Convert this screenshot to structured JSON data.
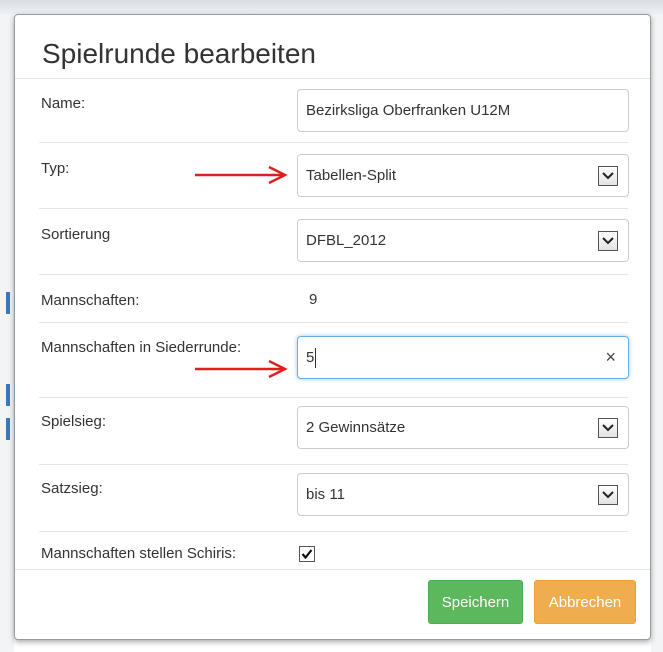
{
  "dialog": {
    "title": "Spielrunde bearbeiten"
  },
  "form": {
    "name": {
      "label": "Name:",
      "value": "Bezirksliga Oberfranken U12M"
    },
    "typ": {
      "label": "Typ:",
      "value": "Tabellen-Split"
    },
    "sortierung": {
      "label": "Sortierung",
      "value": "DFBL_2012"
    },
    "mannschaften": {
      "label": "Mannschaften:",
      "value": "9"
    },
    "siederrunde": {
      "label": "Mannschaften in Siederrunde:",
      "value": "5",
      "clear_icon": "×"
    },
    "spielsieg": {
      "label": "Spielsieg:",
      "value": "2 Gewinnsätze"
    },
    "satzsieg": {
      "label": "Satzsieg:",
      "value": "bis 11"
    },
    "schiris": {
      "label": "Mannschaften stellen Schiris:",
      "checked": true
    }
  },
  "footer": {
    "save_label": "Speichern",
    "cancel_label": "Abbrechen"
  },
  "colors": {
    "save": "#5cb85c",
    "cancel": "#f0ad4e",
    "annotation_arrow": "#e02020",
    "focus": "#66afe9"
  },
  "icons": {
    "select": "chevron-down-icon",
    "clear": "close-icon",
    "checkbox": "check-icon",
    "annotation": "red-arrow-icon"
  }
}
